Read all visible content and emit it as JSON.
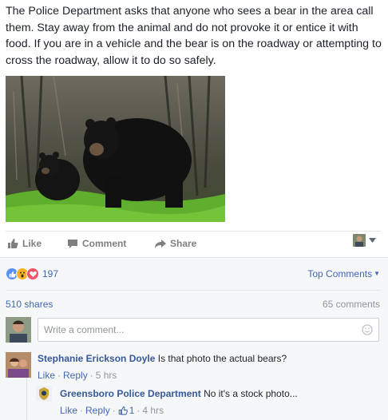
{
  "post": {
    "text": "The Police Department asks that anyone who sees a bear in the area call them. Stay away from the animal and do not provoke it or entice it with food. If you are in a vehicle and the bear is on the roadway or attempting to cross the roadway, allow it to do so safely."
  },
  "actions": {
    "like_label": "Like",
    "comment_label": "Comment",
    "share_label": "Share"
  },
  "feedback": {
    "reaction_icons": [
      "like-reaction",
      "wow-reaction",
      "love-reaction"
    ],
    "reaction_count": "197",
    "top_comments_label": "Top Comments",
    "shares_label": "510 shares",
    "comments_label": "65 comments"
  },
  "composer": {
    "placeholder": "Write a comment..."
  },
  "comments": [
    {
      "author": "Stephanie Erickson Doyle",
      "text": "Is that photo the actual bears?",
      "like_label": "Like",
      "reply_label": "Reply",
      "time": "5 hrs"
    },
    {
      "author": "Greensboro Police Department",
      "text": "No it's a stock photo...",
      "like_label": "Like",
      "reply_label": "Reply",
      "like_count": "1",
      "time": "4 hrs"
    }
  ],
  "colors": {
    "link": "#4267b2",
    "author": "#365899",
    "muted": "#90949c",
    "like_blue": "#5890ff",
    "wow_yellow": "#f7b125",
    "love_red": "#f25268"
  }
}
